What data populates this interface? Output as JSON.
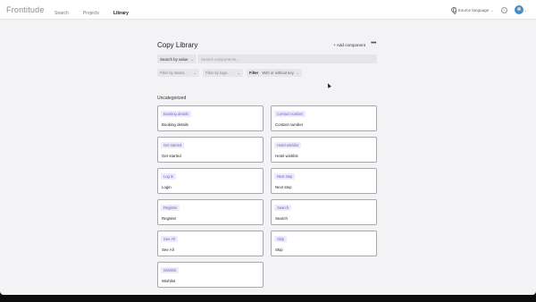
{
  "app": {
    "logo": "Frontitude"
  },
  "nav": [
    "Search",
    "Projects",
    "Library"
  ],
  "header": {
    "language_label": "Source language",
    "help_glyph": "?"
  },
  "page": {
    "title": "Copy Library",
    "add_label": "+ Add component",
    "more_glyph": "•••"
  },
  "search": {
    "mode": "Search by value",
    "placeholder": "Search components..."
  },
  "filters": {
    "status": "Filter by status...",
    "tags": "Filter by tags...",
    "key_label": "Filter",
    "key_value": "With or without key"
  },
  "section_title": "Uncategorized",
  "cards": [
    {
      "name": "Booking details",
      "text": "Booking details"
    },
    {
      "name": "Contact number",
      "text": "Contact number"
    },
    {
      "name": "Get started",
      "text": "Get started"
    },
    {
      "name": "Hotel wishlist",
      "text": "Hotel wishlist"
    },
    {
      "name": "Log in",
      "text": "Login"
    },
    {
      "name": "Next step",
      "text": "Next step"
    },
    {
      "name": "Register",
      "text": "Register"
    },
    {
      "name": "Search",
      "text": "Search"
    },
    {
      "name": "See All",
      "text": "See All"
    },
    {
      "name": "Skip",
      "text": "Skip"
    },
    {
      "name": "Wishlist",
      "text": "Wishlist"
    }
  ],
  "colors": {
    "chip_bg": "#ecebf9",
    "chip_text": "#6a64c9",
    "background": "#f3f3f5"
  },
  "icons": [
    "globe-icon",
    "chevron-down-icon",
    "help-icon",
    "avatar",
    "more-icon",
    "cursor-icon"
  ]
}
